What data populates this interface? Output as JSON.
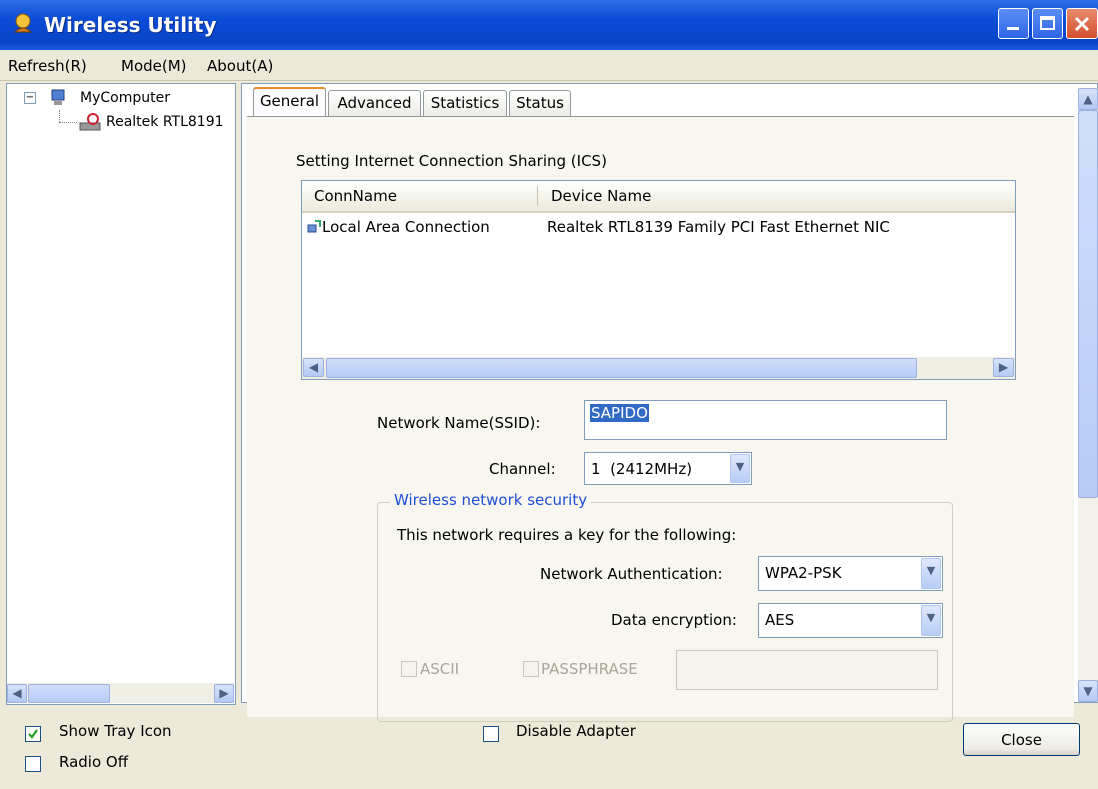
{
  "window": {
    "title": "Wireless Utility"
  },
  "menu": [
    "Refresh(R)",
    "Mode(M)",
    "About(A)"
  ],
  "tree": {
    "root": "MyComputer",
    "expander": "⊟",
    "child": "Realtek RTL8191"
  },
  "tabs": [
    "General",
    "Advanced",
    "Statistics",
    "Status"
  ],
  "ics": {
    "label": "Setting Internet Connection Sharing (ICS)",
    "columns": [
      "ConnName",
      "Device Name"
    ],
    "rows": [
      {
        "conn": "Local Area Connection",
        "device": "Realtek RTL8139 Family PCI Fast Ethernet NIC"
      }
    ]
  },
  "network": {
    "ssid_label": "Network Name(SSID):",
    "ssid_value": "SAPIDO",
    "channel_label": "Channel:",
    "channel_value": "1  (2412MHz)"
  },
  "security": {
    "legend": "Wireless network security",
    "requires_text": "This network requires a key for the following:",
    "auth_label": "Network Authentication:",
    "auth_value": "WPA2-PSK",
    "enc_label": "Data encryption:",
    "enc_value": "AES",
    "ascii_label": "ASCII",
    "passphrase_label": "PASSPHRASE"
  },
  "footer": {
    "show_tray_label": "Show Tray Icon",
    "show_tray_checked": true,
    "radio_off_label": "Radio Off",
    "disable_adapter_label": "Disable Adapter",
    "close_label": "Close"
  },
  "colors": {
    "titlebar": "#0a4bd6",
    "accent_link": "#1f4fd6",
    "selection": "#316ac5"
  }
}
